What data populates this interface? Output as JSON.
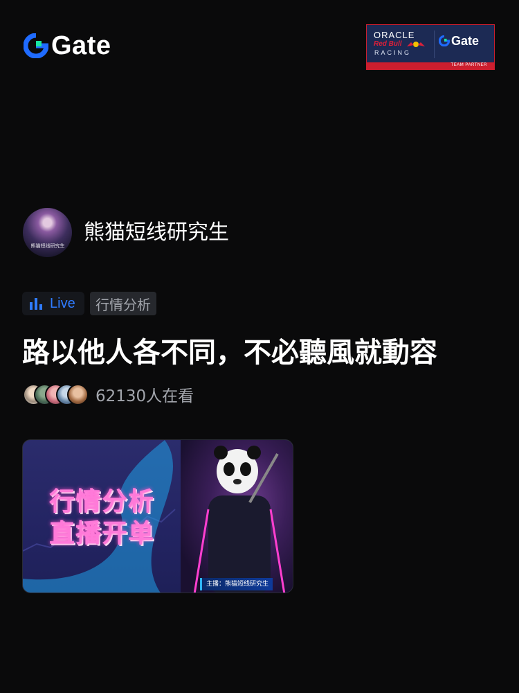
{
  "header": {
    "logo_text": "Gate",
    "logo_icon": "gate-logo-icon",
    "partner": {
      "oracle": "ORACLE",
      "redbull": "Red Bull",
      "racing": "RACING",
      "gate_text": "Gate",
      "strip_text": "TEAM PARTNER"
    }
  },
  "host": {
    "name": "熊猫短线研究生",
    "avatar_label": "熊猫短线研究生"
  },
  "tags": {
    "live": "Live",
    "category": "行情分析"
  },
  "stream": {
    "title": "路以他人各不同，不必聽風就動容",
    "viewer_count": "62130人在看"
  },
  "thumbnail": {
    "line1": "行情分析",
    "line2": "直播开单",
    "host_badge": "主播：熊猫短线研究生"
  },
  "colors": {
    "background": "#0a0a0b",
    "accent": "#2f7bff",
    "logo_green": "#17e6a1",
    "partner_red": "#cc1e2e",
    "partner_navy": "#1c2a54"
  }
}
